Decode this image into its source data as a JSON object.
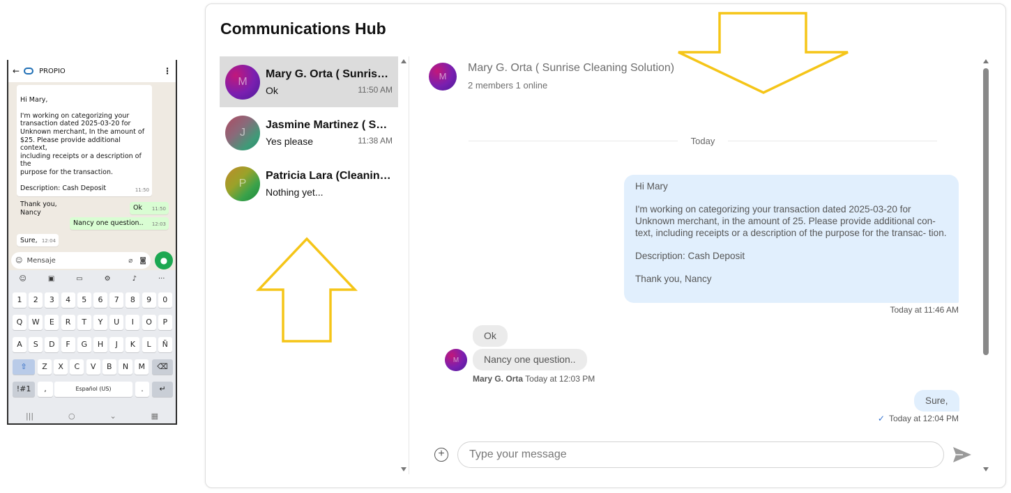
{
  "phone": {
    "app_name": "PROPIO",
    "messages_in": [
      {
        "text": "Hi Mary,\n\nI'm working on categorizing your\ntransaction dated 2025-03-20 for\nUnknown merchant, In the amount of\n$25. Please provide additional context,\nincluding receipts or a description of the\npurpose for the transaction.\n\nDescription: Cash Deposit\n\nThank you,\nNancy",
        "time": "11:50"
      },
      {
        "text": "Sure,",
        "time": "12:04"
      }
    ],
    "messages_out": [
      {
        "text": "Ok",
        "time": "11:50"
      },
      {
        "text": "Nancy one question..",
        "time": "12:03"
      }
    ],
    "compose_placeholder": "Mensaje",
    "keyboard": {
      "row1": [
        "1",
        "2",
        "3",
        "4",
        "5",
        "6",
        "7",
        "8",
        "9",
        "0"
      ],
      "row2": [
        "Q",
        "W",
        "E",
        "R",
        "T",
        "Y",
        "U",
        "I",
        "O",
        "P"
      ],
      "row3": [
        "A",
        "S",
        "D",
        "F",
        "G",
        "H",
        "J",
        "K",
        "L",
        "Ñ"
      ],
      "row4": [
        "Z",
        "X",
        "C",
        "V",
        "B",
        "N",
        "M"
      ],
      "symbols_key": "!#1",
      "comma_key": ",",
      "space_key": "Español (US)",
      "period_key": "."
    }
  },
  "hub": {
    "title": "Communications Hub",
    "conversations": [
      {
        "avatar": "M",
        "name": "Mary G. Orta ( Sunrise Cleaning Solution)",
        "preview": "Ok",
        "time": "11:50 AM",
        "active": true
      },
      {
        "avatar": "J",
        "name": "Jasmine Martinez ( Sunrise Cleaning Solution)",
        "preview": "Yes please",
        "time": "11:38 AM",
        "active": false
      },
      {
        "avatar": "P",
        "name": "Patricia Lara (Cleaning Solution)",
        "preview": "Nothing yet...",
        "time": "",
        "active": false
      }
    ],
    "chat": {
      "avatar": "M",
      "name": "Mary G. Orta ( Sunrise Cleaning Solution)",
      "members": "2 members 1 online",
      "day_label": "Today",
      "outgoing_1": {
        "greeting": "Hi Mary",
        "body": "I'm working on categorizing your transaction dated 2025-03-20 for Unknown merchant, in the amount of 25. Please provide additional con- text, including receipts or a description of the purpose for the transac- tion.",
        "description": "Description: Cash Deposit",
        "signoff": "Thank you, Nancy",
        "time": "Today at 11:46 AM"
      },
      "incoming": [
        {
          "text": "Ok"
        },
        {
          "text": "Nancy one question.."
        }
      ],
      "incoming_avatar": "M",
      "incoming_sender": "Mary G. Orta",
      "incoming_time": "Today at 12:03 PM",
      "outgoing_2": {
        "text": "Sure,",
        "time": "Today at 12:04 PM"
      },
      "compose_placeholder": "Type your message"
    }
  },
  "colors": {
    "annotation_arrow": "#f5c518",
    "outgoing_bubble": "#e1effd",
    "incoming_bubble": "#ebebeb",
    "active_conversation": "#dcdcdc"
  },
  "icons": [
    "back-arrow-icon",
    "propio-logo-icon",
    "more-options-icon",
    "emoji-icon",
    "attach-icon",
    "camera-icon",
    "mic-icon",
    "plus-circle-icon",
    "send-icon",
    "read-check-icon"
  ]
}
